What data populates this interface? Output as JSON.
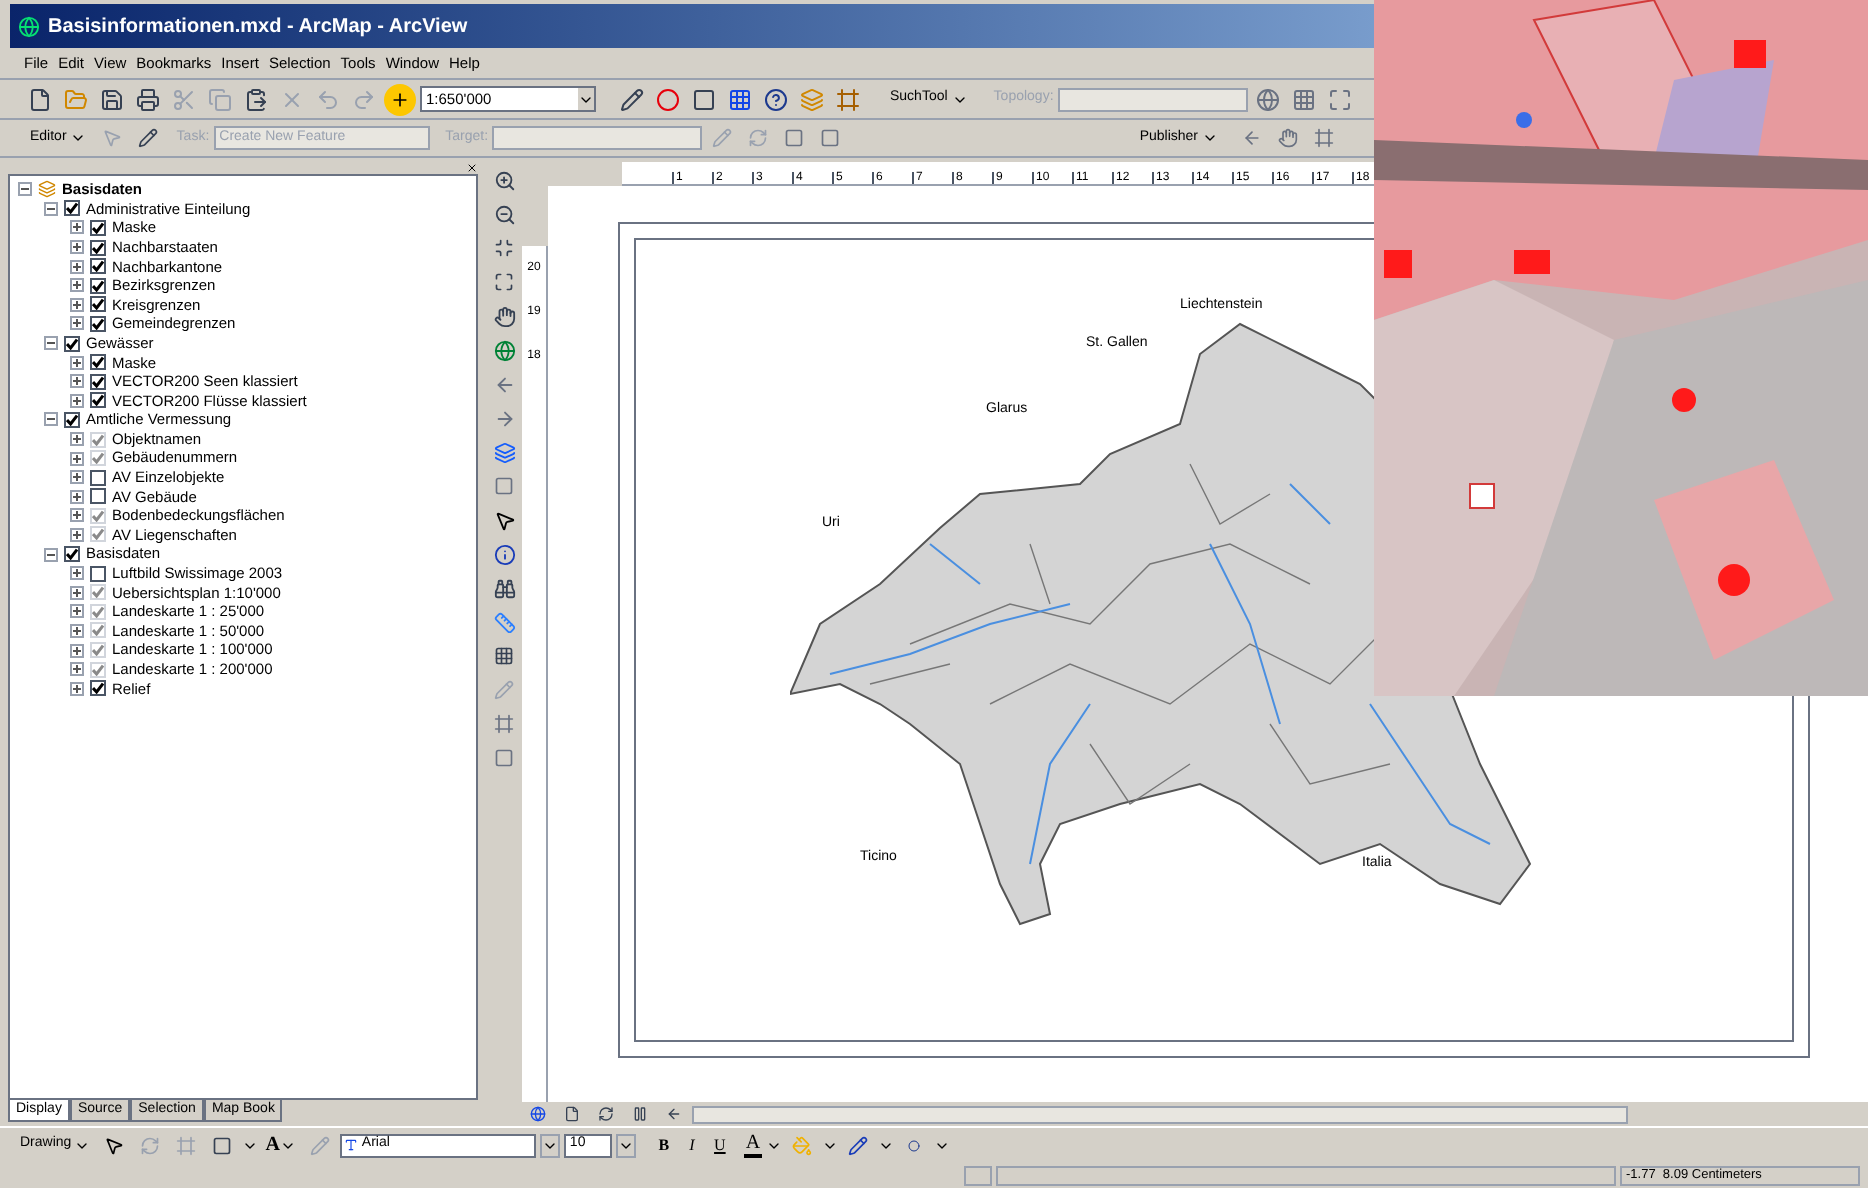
{
  "window": {
    "title": "Basisinformationen.mxd - ArcMap - ArcView"
  },
  "menu": [
    "File",
    "Edit",
    "View",
    "Bookmarks",
    "Insert",
    "Selection",
    "Tools",
    "Window",
    "Help"
  ],
  "standard_toolbar": {
    "scale": "1:650'000",
    "suchtool": "SuchTool",
    "topology_label": "Topology:"
  },
  "editor_toolbar": {
    "editor": "Editor",
    "task_label": "Task:",
    "task": "Create New Feature",
    "target_label": "Target:",
    "publisher": "Publisher"
  },
  "toc": {
    "tree": [
      {
        "label": "Basisdaten",
        "kind": "dataframe",
        "expanded": true,
        "children": [
          {
            "label": "Administrative Einteilung",
            "kind": "layer",
            "checked": true,
            "disabled": false,
            "expanded": true,
            "children": [
              {
                "label": "Maske",
                "kind": "layer",
                "checked": true,
                "disabled": false,
                "expanded": false
              },
              {
                "label": "Nachbarstaaten",
                "kind": "layer",
                "checked": true,
                "disabled": false,
                "expanded": false
              },
              {
                "label": "Nachbarkantone",
                "kind": "layer",
                "checked": true,
                "disabled": false,
                "expanded": false
              },
              {
                "label": "Bezirksgrenzen",
                "kind": "layer",
                "checked": true,
                "disabled": false,
                "expanded": false
              },
              {
                "label": "Kreisgrenzen",
                "kind": "layer",
                "checked": true,
                "disabled": false,
                "expanded": false
              },
              {
                "label": "Gemeindegrenzen",
                "kind": "layer",
                "checked": true,
                "disabled": false,
                "expanded": false
              }
            ]
          },
          {
            "label": "Gewässer",
            "kind": "layer",
            "checked": true,
            "disabled": false,
            "expanded": true,
            "children": [
              {
                "label": "Maske",
                "kind": "layer",
                "checked": true,
                "disabled": false,
                "expanded": false
              },
              {
                "label": "VECTOR200 Seen klassiert",
                "kind": "layer",
                "checked": true,
                "disabled": false,
                "expanded": false
              },
              {
                "label": "VECTOR200 Flüsse klassiert",
                "kind": "layer",
                "checked": true,
                "disabled": false,
                "expanded": false
              }
            ]
          },
          {
            "label": "Amtliche Vermessung",
            "kind": "layer",
            "checked": true,
            "disabled": false,
            "expanded": true,
            "children": [
              {
                "label": "Objektnamen",
                "kind": "layer",
                "checked": true,
                "disabled": true,
                "expanded": false
              },
              {
                "label": "Gebäudenummern",
                "kind": "layer",
                "checked": true,
                "disabled": true,
                "expanded": false
              },
              {
                "label": "AV Einzelobjekte",
                "kind": "layer",
                "checked": false,
                "disabled": false,
                "expanded": false
              },
              {
                "label": "AV Gebäude",
                "kind": "layer",
                "checked": false,
                "disabled": false,
                "expanded": false
              },
              {
                "label": "Bodenbedeckungsflächen",
                "kind": "layer",
                "checked": true,
                "disabled": true,
                "expanded": false
              },
              {
                "label": "AV Liegenschaften",
                "kind": "layer",
                "checked": true,
                "disabled": true,
                "expanded": false
              }
            ]
          },
          {
            "label": "Basisdaten",
            "kind": "layer",
            "checked": true,
            "disabled": false,
            "expanded": true,
            "children": [
              {
                "label": "Luftbild Swissimage 2003",
                "kind": "layer",
                "checked": false,
                "disabled": false,
                "expanded": false
              },
              {
                "label": "Uebersichtsplan 1:10'000",
                "kind": "layer",
                "checked": true,
                "disabled": true,
                "expanded": false
              },
              {
                "label": "Landeskarte 1 : 25'000",
                "kind": "layer",
                "checked": true,
                "disabled": true,
                "expanded": false
              },
              {
                "label": "Landeskarte 1 : 50'000",
                "kind": "layer",
                "checked": true,
                "disabled": true,
                "expanded": false
              },
              {
                "label": "Landeskarte 1 : 100'000",
                "kind": "layer",
                "checked": true,
                "disabled": true,
                "expanded": false
              },
              {
                "label": "Landeskarte 1 : 200'000",
                "kind": "layer",
                "checked": true,
                "disabled": true,
                "expanded": false
              },
              {
                "label": "Relief",
                "kind": "layer",
                "checked": true,
                "disabled": false,
                "expanded": false
              }
            ]
          }
        ]
      }
    ],
    "tabs": [
      {
        "label": "Display",
        "selected": true
      },
      {
        "label": "Source",
        "selected": false
      },
      {
        "label": "Selection",
        "selected": false
      },
      {
        "label": "Map Book",
        "selected": false
      }
    ]
  },
  "ruler": {
    "ticks": [
      "1",
      "2",
      "3",
      "4",
      "5",
      "6",
      "7",
      "8",
      "9",
      "10",
      "11",
      "12",
      "13",
      "14",
      "15",
      "16",
      "17",
      "18"
    ],
    "vertical_ticks": [
      "20",
      "19",
      "18"
    ]
  },
  "map": {
    "labels": [
      "Liechtenstein",
      "St. Gallen",
      "Glarus",
      "Uri",
      "Ticino",
      "Italia"
    ]
  },
  "drawing_toolbar": {
    "drawing": "Drawing",
    "text_tool": "A",
    "font": "Arial",
    "size": "10",
    "bold": "B",
    "italic": "I",
    "underline": "U",
    "font_color": "A"
  },
  "status_bar": {
    "coordinates": "-1.77  8.09 Centimeters"
  }
}
